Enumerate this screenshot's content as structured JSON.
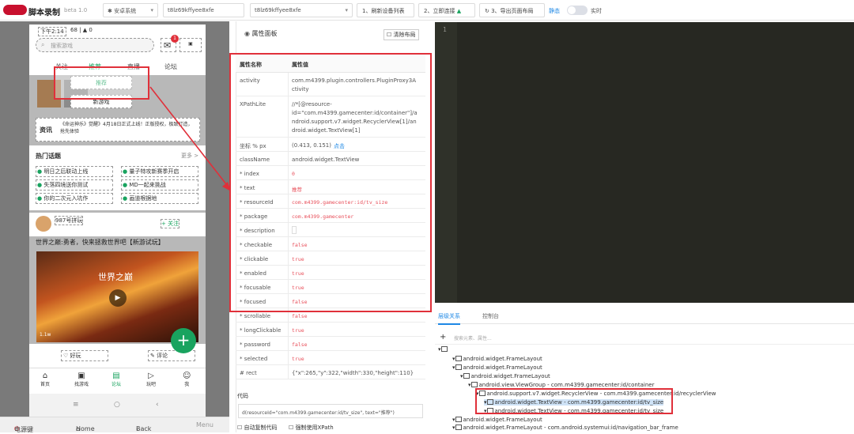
{
  "app": {
    "title": "脚本录制",
    "version": "beta 1.0"
  },
  "toolbar": {
    "os_select": "安卓系统",
    "device_select_1": "t8lz69kffyee8xfe",
    "device_select_2": "t8lz69kffyee8xfe",
    "refresh_label": "1、刷新设备列表",
    "connect_label": "2、立即连接",
    "export_label": "3、导出页面布局",
    "static_label": "静态",
    "realtime_label": "实时"
  },
  "phone": {
    "status_time": "下午2:14",
    "status_info": "68 | ▲ 0",
    "search_placeholder": "搜索游戏",
    "badge_count": "1",
    "tabs": [
      "关注",
      "推荐",
      "直播",
      "论坛"
    ],
    "dropdown_item_1": "推荐",
    "dropdown_item_2": "新游戏",
    "news_tag": "资讯",
    "news_text": "《命运神乐》觉醒》4月18日正式上线！正版授权，极致打造，抢先体验",
    "hot_title": "热门话题",
    "hot_more": "更多 >",
    "topics": [
      "明日之后联动上线",
      "量子特攻新赛季开启",
      "失落四境送你测试",
      "MD一起来挑战",
      "你的二次元入坑作",
      "画道根据地"
    ],
    "post_author": "987号拼玩",
    "post_follow": "+ 关注",
    "post_title": "世界之巅:勇者，快来拯救世界吧【新游试玩】",
    "post_game_title": "世界之巅",
    "video_count": "1.1w",
    "like_label": "好玩",
    "comment_label": "评论",
    "nav_items": [
      "首页",
      "找游戏",
      "论坛",
      "玩吧",
      "我"
    ]
  },
  "bottom_nav": {
    "power": "电源键",
    "home": "Home",
    "back": "Back",
    "menu": "Menu"
  },
  "props": {
    "panel_title": "属性面板",
    "clear_label": "清除布局",
    "col_name": "属性名称",
    "col_value": "属性值",
    "rows": [
      {
        "k": "activity",
        "v": "com.m4399.plugin.controllers.PluginProxy3A",
        "v2": "ctivity"
      },
      {
        "k": "XPathLite",
        "v": "//*[@resource-",
        "v2": "id=\"com.m4399.gamecenter:id/container\"]/a",
        "v3": "ndroid.support.v7.widget.RecyclerView[1]/an",
        "v4": "droid.widget.TextView[1]"
      },
      {
        "k": "坐标 % px",
        "v": "(0.413, 0.151)",
        "v2": "点击"
      },
      {
        "k": "className",
        "v": "android.widget.TextView"
      },
      {
        "k": "* index",
        "v": "0"
      },
      {
        "k": "* text",
        "v": "推荐"
      },
      {
        "k": "* resourceId",
        "v": "com.m4399.gamecenter:id/tv_size"
      },
      {
        "k": "* package",
        "v": "com.m4399.gamecenter"
      },
      {
        "k": "* description",
        "v": ""
      },
      {
        "k": "* checkable",
        "v": "false"
      },
      {
        "k": "* clickable",
        "v": "true"
      },
      {
        "k": "* enabled",
        "v": "true"
      },
      {
        "k": "* focusable",
        "v": "true"
      },
      {
        "k": "* focused",
        "v": "false"
      },
      {
        "k": "* scrollable",
        "v": "false"
      },
      {
        "k": "* longClickable",
        "v": "true"
      },
      {
        "k": "* password",
        "v": "false"
      },
      {
        "k": "* selected",
        "v": "true"
      },
      {
        "k": "# rect",
        "v": "{\"x\":265,\"y\":322,\"width\":330,\"height\":110}"
      }
    ],
    "code_label": "代码",
    "code_value": "d(resourceId=\"com.m4399.gamecenter:id/tv_size\", text=\"推荐\")",
    "auto_copy": "自动复制代码",
    "force_xpath": "强制使用XPath"
  },
  "editor": {
    "line_number": "1"
  },
  "bottom_panel": {
    "tabs": [
      "层级关系",
      "控制台"
    ],
    "search_placeholder": "搜索元素、属性...",
    "tree": [
      "android.widget.FrameLayout",
      "android.widget.FrameLayout",
      "android.widget.FrameLayout",
      "android.view.ViewGroup - com.m4399.gamecenter:id/container",
      "android.support.v7.widget.RecyclerView - com.m4399.gamecenter:id/recyclerView",
      "android.widget.TextView - com.m4399.gamecenter:id/tv_size",
      "android.widget.TextView - com.m4399.gamecenter:id/tv_size",
      "android.widget.FrameLayout",
      "android.widget.FrameLayout - com.android.systemui:id/navigation_bar_frame"
    ]
  },
  "colors": {
    "accent": "#e0303a",
    "link": "#1e88e5",
    "green": "#19a35f",
    "editor_bg": "#272822"
  }
}
